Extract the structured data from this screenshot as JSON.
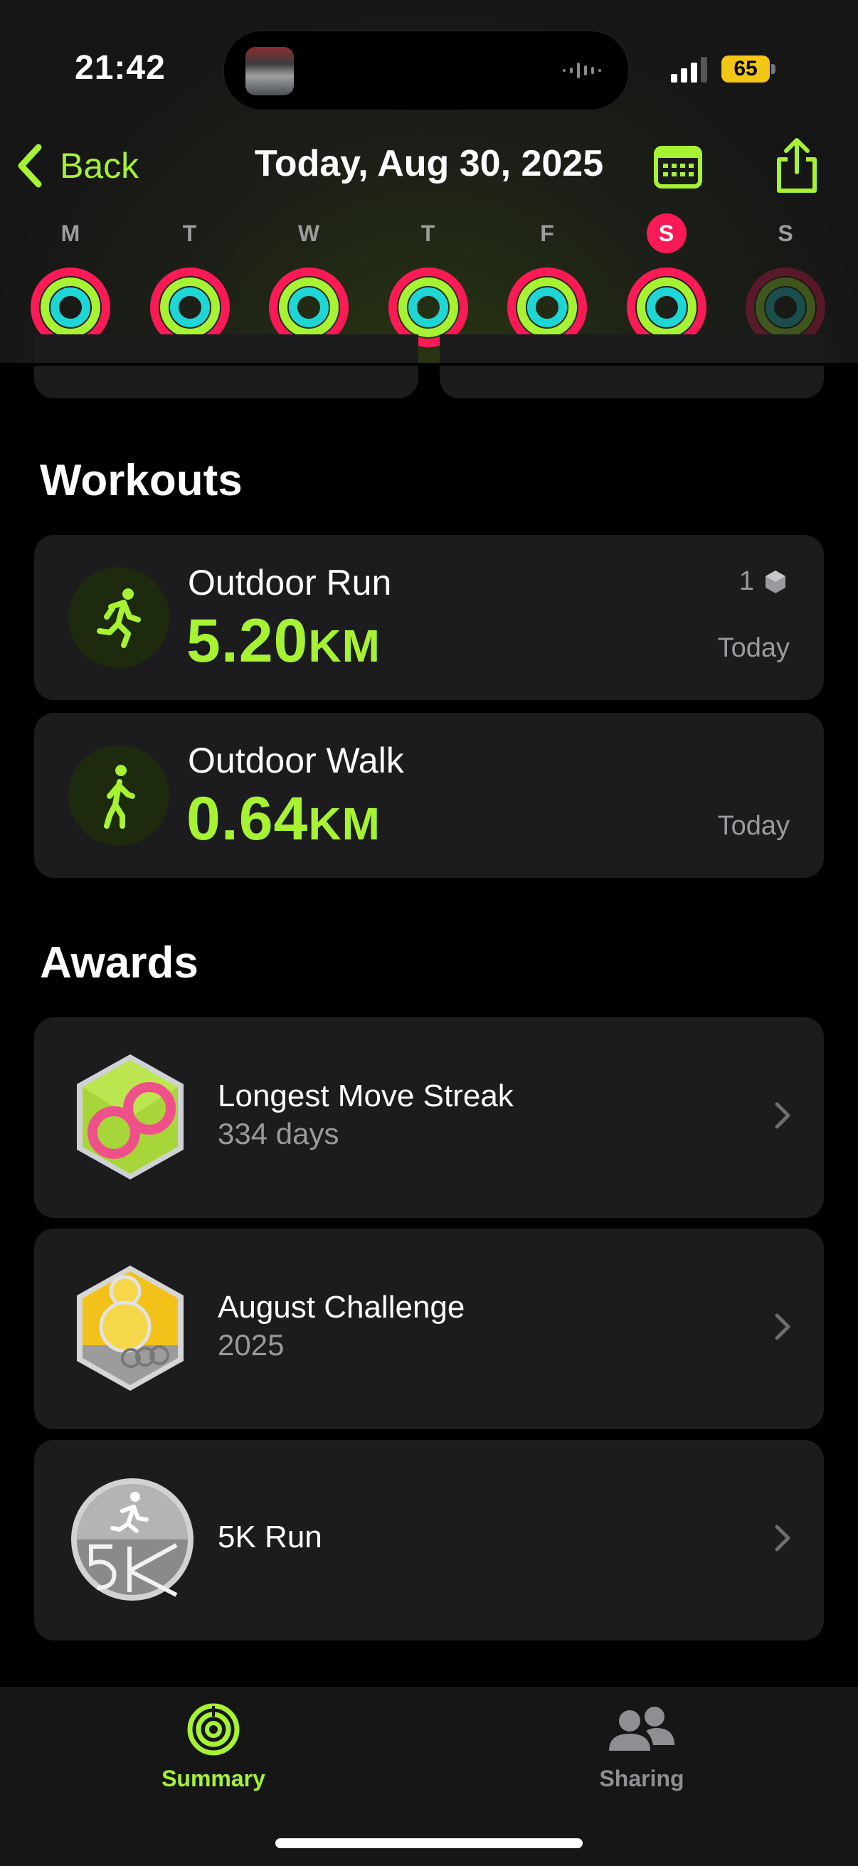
{
  "status_bar": {
    "time": "21:42",
    "battery": "65"
  },
  "header": {
    "back_label": "Back",
    "title": "Today, Aug 30, 2025"
  },
  "week": [
    {
      "label": "M",
      "selected": false,
      "faded": false
    },
    {
      "label": "T",
      "selected": false,
      "faded": false
    },
    {
      "label": "W",
      "selected": false,
      "faded": false
    },
    {
      "label": "T",
      "selected": false,
      "faded": false
    },
    {
      "label": "F",
      "selected": false,
      "faded": false
    },
    {
      "label": "S",
      "selected": true,
      "faded": false
    },
    {
      "label": "S",
      "selected": false,
      "faded": true
    }
  ],
  "workouts": {
    "title": "Workouts",
    "items": [
      {
        "name": "Outdoor Run",
        "value": "5.20",
        "unit": "KM",
        "date": "Today",
        "badge_count": "1",
        "icon": "running-figure-icon"
      },
      {
        "name": "Outdoor Walk",
        "value": "0.64",
        "unit": "KM",
        "date": "Today",
        "icon": "walking-figure-icon"
      }
    ]
  },
  "awards": {
    "title": "Awards",
    "items": [
      {
        "title": "Longest Move Streak",
        "subtitle": "334 days",
        "icon": "move-streak-badge-icon"
      },
      {
        "title": "August Challenge",
        "subtitle": "2025",
        "icon": "august-challenge-badge-icon"
      },
      {
        "title": "5K Run",
        "subtitle": "",
        "icon": "5k-run-medal-icon"
      }
    ]
  },
  "tabs": [
    {
      "label": "Summary",
      "active": true,
      "icon": "activity-rings-icon"
    },
    {
      "label": "Sharing",
      "active": false,
      "icon": "people-icon"
    }
  ],
  "colors": {
    "accent": "#a6f233",
    "move": "#fa1a56",
    "exercise": "#a6f233",
    "stand": "#1fd6d6",
    "card": "#1c1c1e"
  }
}
